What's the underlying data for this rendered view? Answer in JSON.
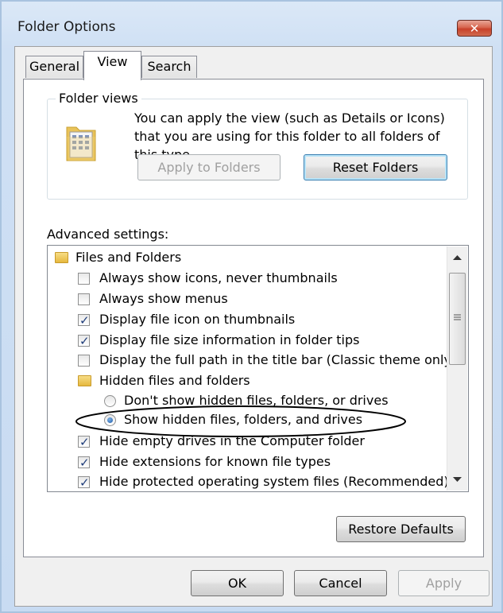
{
  "window": {
    "title": "Folder Options",
    "close_label": "✕"
  },
  "tabs": [
    {
      "label": "General"
    },
    {
      "label": "View",
      "selected": true
    },
    {
      "label": "Search"
    }
  ],
  "folder_views": {
    "heading": "Folder views",
    "description": "You can apply the view (such as Details or Icons) that you are using for this folder to all folders of this type.",
    "apply_button": "Apply to Folders",
    "reset_button": "Reset Folders"
  },
  "advanced": {
    "heading": "Advanced settings:",
    "items": [
      {
        "kind": "folder",
        "label": "Files and Folders"
      },
      {
        "kind": "checkbox",
        "label": "Always show icons, never thumbnails",
        "checked": false
      },
      {
        "kind": "checkbox",
        "label": "Always show menus",
        "checked": false
      },
      {
        "kind": "checkbox",
        "label": "Display file icon on thumbnails",
        "checked": true
      },
      {
        "kind": "checkbox",
        "label": "Display file size information in folder tips",
        "checked": true
      },
      {
        "kind": "checkbox",
        "label": "Display the full path in the title bar (Classic theme only)",
        "checked": false
      },
      {
        "kind": "folder",
        "label": "Hidden files and folders"
      },
      {
        "kind": "radio",
        "label": "Don't show hidden files, folders, or drives",
        "checked": false
      },
      {
        "kind": "radio",
        "label": "Show hidden files, folders, and drives",
        "checked": true
      },
      {
        "kind": "checkbox",
        "label": "Hide empty drives in the Computer folder",
        "checked": true
      },
      {
        "kind": "checkbox",
        "label": "Hide extensions for known file types",
        "checked": true
      },
      {
        "kind": "checkbox",
        "label": "Hide protected operating system files (Recommended)",
        "checked": true
      }
    ],
    "restore_button": "Restore Defaults"
  },
  "footer": {
    "ok": "OK",
    "cancel": "Cancel",
    "apply": "Apply"
  },
  "colors": {
    "annotation": "#000000",
    "selection_accent": "#3c7fb1"
  }
}
